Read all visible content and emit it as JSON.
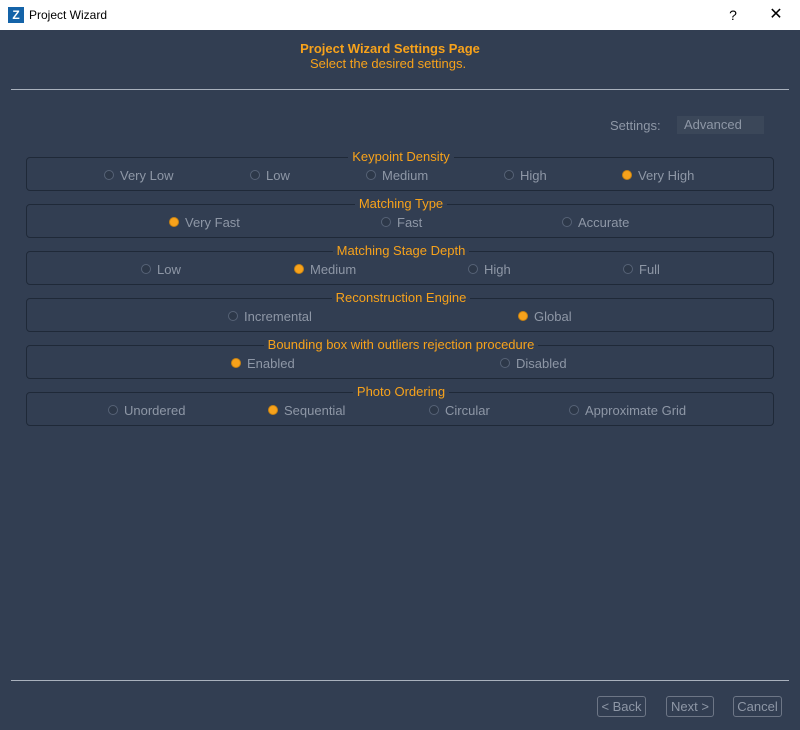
{
  "window": {
    "icon_letter": "Z",
    "title": "Project Wizard",
    "help_glyph": "?",
    "close_glyph": "✕"
  },
  "header": {
    "title": "Project Wizard Settings Page",
    "subtitle": "Select the desired settings."
  },
  "settings": {
    "label": "Settings:",
    "value": "Advanced"
  },
  "groups": [
    {
      "title": "Keypoint Density",
      "options": [
        "Very Low",
        "Low",
        "Medium",
        "High",
        "Very High"
      ],
      "selected": "Very High"
    },
    {
      "title": "Matching Type",
      "options": [
        "Very Fast",
        "Fast",
        "Accurate"
      ],
      "selected": "Very Fast"
    },
    {
      "title": "Matching Stage Depth",
      "options": [
        "Low",
        "Medium",
        "High",
        "Full"
      ],
      "selected": "Medium"
    },
    {
      "title": "Reconstruction Engine",
      "options": [
        "Incremental",
        "Global"
      ],
      "selected": "Global"
    },
    {
      "title": "Bounding box with outliers rejection procedure",
      "options": [
        "Enabled",
        "Disabled"
      ],
      "selected": "Enabled"
    },
    {
      "title": "Photo Ordering",
      "options": [
        "Unordered",
        "Sequential",
        "Circular",
        "Approximate Grid"
      ],
      "selected": "Sequential"
    }
  ],
  "footer": {
    "back_label": "< Back",
    "next_label": "Next >",
    "cancel_label": "Cancel"
  },
  "colors": {
    "background": "#323e52",
    "accent": "#f7a21b",
    "muted_text": "#8e97a6"
  }
}
